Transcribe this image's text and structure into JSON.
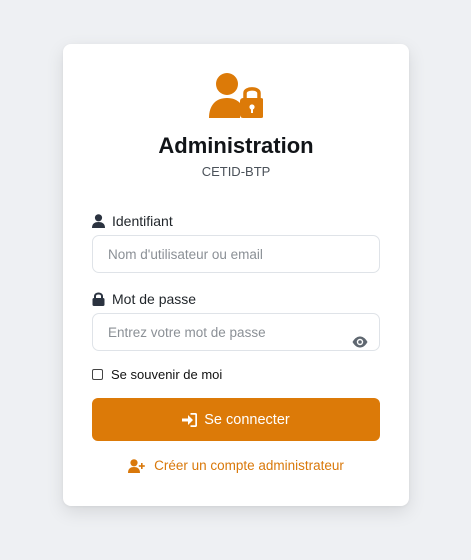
{
  "login": {
    "title": "Administration",
    "subtitle": "CETID-BTP",
    "username": {
      "label": "Identifiant",
      "placeholder": "Nom d'utilisateur ou email",
      "value": "",
      "icon": "user-icon"
    },
    "password": {
      "label": "Mot de passe",
      "placeholder": "Entrez votre mot de passe",
      "value": "",
      "icon": "lock-icon",
      "toggle_icon": "eye-icon"
    },
    "remember": {
      "label": "Se souvenir de moi",
      "checked": false
    },
    "submit": {
      "label": "Se connecter",
      "icon": "sign-in-icon"
    },
    "create_account": {
      "label": "Créer un compte administrateur",
      "icon": "user-plus-icon"
    }
  },
  "colors": {
    "accent": "#dc7a08",
    "background": "#eef0f3",
    "card": "#ffffff",
    "text": "#111418"
  }
}
